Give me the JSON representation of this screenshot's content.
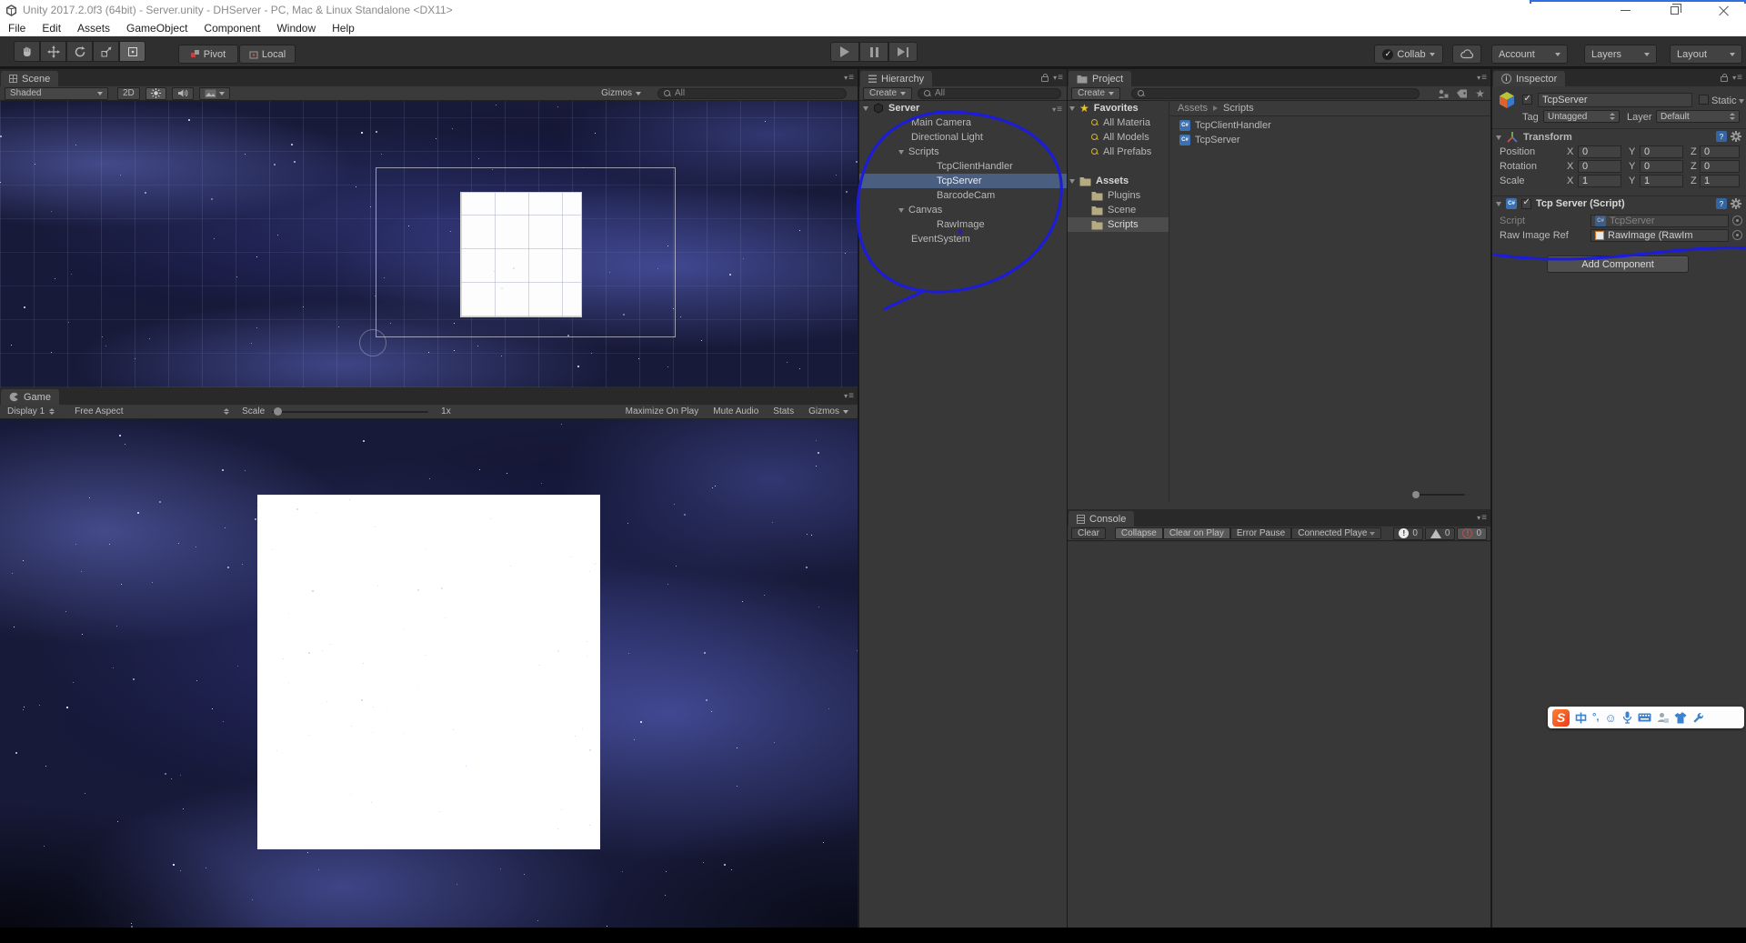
{
  "titlebar": {
    "title": "Unity 2017.2.0f3 (64bit) - Server.unity - DHServer - PC, Mac & Linux Standalone <DX11>"
  },
  "menubar": {
    "items": [
      "File",
      "Edit",
      "Assets",
      "GameObject",
      "Component",
      "Window",
      "Help"
    ]
  },
  "toolbar": {
    "pivot_label": "Pivot",
    "local_label": "Local",
    "collab_label": "Collab",
    "account_label": "Account",
    "layers_label": "Layers",
    "layout_label": "Layout"
  },
  "scene_view": {
    "tab_label": "Scene",
    "shading_mode": "Shaded",
    "toggle_2d": "2D",
    "gizmos_label": "Gizmos",
    "search_text": "All"
  },
  "game_view": {
    "tab_label": "Game",
    "display": "Display 1",
    "aspect": "Free Aspect",
    "scale_label": "Scale",
    "scale_value": "1x",
    "maximize_label": "Maximize On Play",
    "mute_label": "Mute Audio",
    "stats_label": "Stats",
    "gizmos_label": "Gizmos"
  },
  "hierarchy": {
    "tab_label": "Hierarchy",
    "create_label": "Create",
    "search_text": "All",
    "root": "Server",
    "items": [
      {
        "label": "Main Camera"
      },
      {
        "label": "Directional Light"
      },
      {
        "label": "Scripts"
      },
      {
        "label": "TcpClientHandler"
      },
      {
        "label": "TcpServer"
      },
      {
        "label": "BarcodeCam"
      },
      {
        "label": "Canvas"
      },
      {
        "label": "RawImage"
      },
      {
        "label": "EventSystem"
      }
    ]
  },
  "project": {
    "tab_label": "Project",
    "create_label": "Create",
    "favorites_label": "Favorites",
    "favorites": [
      {
        "label": "All Materia"
      },
      {
        "label": "All Models"
      },
      {
        "label": "All Prefabs"
      }
    ],
    "assets_label": "Assets",
    "folders": [
      {
        "label": "Plugins"
      },
      {
        "label": "Scene"
      },
      {
        "label": "Scripts"
      }
    ],
    "breadcrumb_root": "Assets",
    "breadcrumb_current": "Scripts",
    "files": [
      {
        "label": "TcpClientHandler"
      },
      {
        "label": "TcpServer"
      }
    ]
  },
  "console": {
    "tab_label": "Console",
    "clear": "Clear",
    "collapse": "Collapse",
    "clear_on_play": "Clear on Play",
    "error_pause": "Error Pause",
    "connected_player": "Connected Playe",
    "info_count": "0",
    "warning_count": "0",
    "error_count": "0"
  },
  "inspector": {
    "tab_label": "Inspector",
    "object_name": "TcpServer",
    "static_label": "Static",
    "tag_label": "Tag",
    "tag_value": "Untagged",
    "layer_label": "Layer",
    "layer_value": "Default",
    "transform": {
      "title": "Transform",
      "axis": [
        "X",
        "Y",
        "Z"
      ],
      "rows": [
        {
          "label": "Position",
          "x": "0",
          "y": "0",
          "z": "0"
        },
        {
          "label": "Rotation",
          "x": "0",
          "y": "0",
          "z": "0"
        },
        {
          "label": "Scale",
          "x": "1",
          "y": "1",
          "z": "1"
        }
      ]
    },
    "tcp_component": {
      "title": "Tcp Server (Script)",
      "script_label": "Script",
      "script_value": "TcpServer",
      "raw_image_label": "Raw Image Ref",
      "raw_image_value": "RawImage (RawIm"
    },
    "add_component_label": "Add Component"
  },
  "ime_bar": {
    "mode": "中",
    "punct": "°,",
    "smiley": "☺"
  },
  "colors": {
    "annotation": "#1c1cd9",
    "selection": "#4a5e80"
  }
}
